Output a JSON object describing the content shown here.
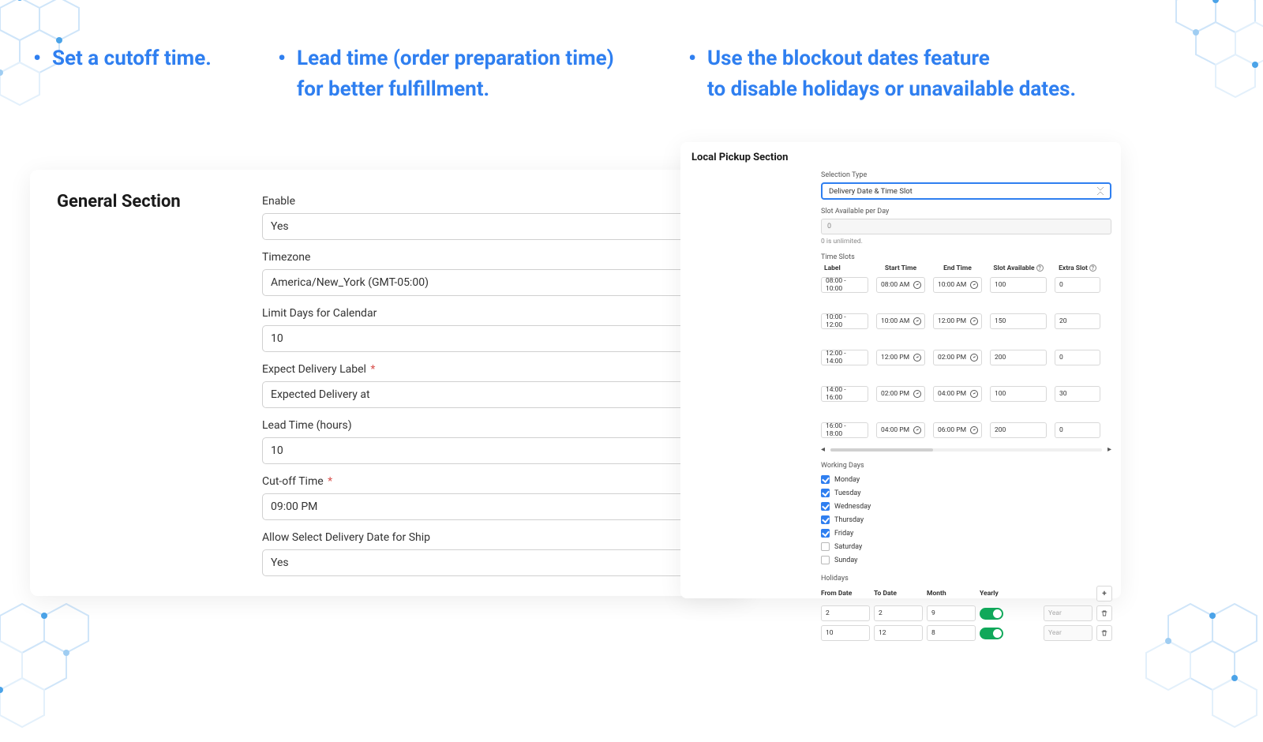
{
  "bullets": {
    "b1": "Set a cutoff time.",
    "b2_l1": "Lead time (order preparation time)",
    "b2_l2": "for better fulfillment.",
    "b3_l1": "Use the blockout dates feature",
    "b3_l2": "to disable holidays or unavailable dates."
  },
  "general": {
    "title": "General Section",
    "enable_label": "Enable",
    "enable_value": "Yes",
    "timezone_label": "Timezone",
    "timezone_value": "America/New_York (GMT-05:00)",
    "limit_label": "Limit Days for Calendar",
    "limit_value": "10",
    "expect_label": "Expect Delivery Label",
    "expect_value": "Expected Delivery at",
    "lead_label": "Lead Time (hours)",
    "lead_value": "10",
    "cutoff_label": "Cut-off Time",
    "cutoff_value": "09:00 PM",
    "allow_label": "Allow Select Delivery Date for Ship",
    "allow_value": "Yes",
    "required": "*"
  },
  "pickup": {
    "title": "Local Pickup Section",
    "selection_type_label": "Selection Type",
    "selection_type_value": "Delivery Date & Time Slot",
    "slot_avail_label": "Slot Available per Day",
    "slot_avail_value": "0",
    "slot_avail_hint": "0 is unlimited.",
    "time_slots_label": "Time Slots",
    "headers": {
      "label": "Label",
      "start": "Start Time",
      "end": "End Time",
      "avail": "Slot Available",
      "extra": "Extra Slot"
    },
    "rows": [
      {
        "label": "08:00 - 10:00",
        "start": "08:00 AM",
        "end": "10:00 AM",
        "avail": "100",
        "extra": "0"
      },
      {
        "label": "10:00 - 12:00",
        "start": "10:00 AM",
        "end": "12:00 PM",
        "avail": "150",
        "extra": "20"
      },
      {
        "label": "12:00 - 14:00",
        "start": "12:00 PM",
        "end": "02:00 PM",
        "avail": "200",
        "extra": "0"
      },
      {
        "label": "14:00 - 16:00",
        "start": "02:00 PM",
        "end": "04:00 PM",
        "avail": "100",
        "extra": "30"
      },
      {
        "label": "16:00 - 18:00",
        "start": "04:00 PM",
        "end": "06:00 PM",
        "avail": "200",
        "extra": "0"
      }
    ],
    "working_days_label": "Working Days",
    "days": [
      {
        "name": "Monday",
        "on": true
      },
      {
        "name": "Tuesday",
        "on": true
      },
      {
        "name": "Wednesday",
        "on": true
      },
      {
        "name": "Thursday",
        "on": true
      },
      {
        "name": "Friday",
        "on": true
      },
      {
        "name": "Saturday",
        "on": false
      },
      {
        "name": "Sunday",
        "on": false
      }
    ],
    "holidays_label": "Holidays",
    "hol_headers": {
      "from": "From Date",
      "to": "To Date",
      "month": "Month",
      "yearly": "Yearly"
    },
    "hol_placeholder_year": "Year",
    "hol_add": "+",
    "holidays": [
      {
        "from": "2",
        "to": "2",
        "month": "9"
      },
      {
        "from": "10",
        "to": "12",
        "month": "8"
      }
    ]
  }
}
